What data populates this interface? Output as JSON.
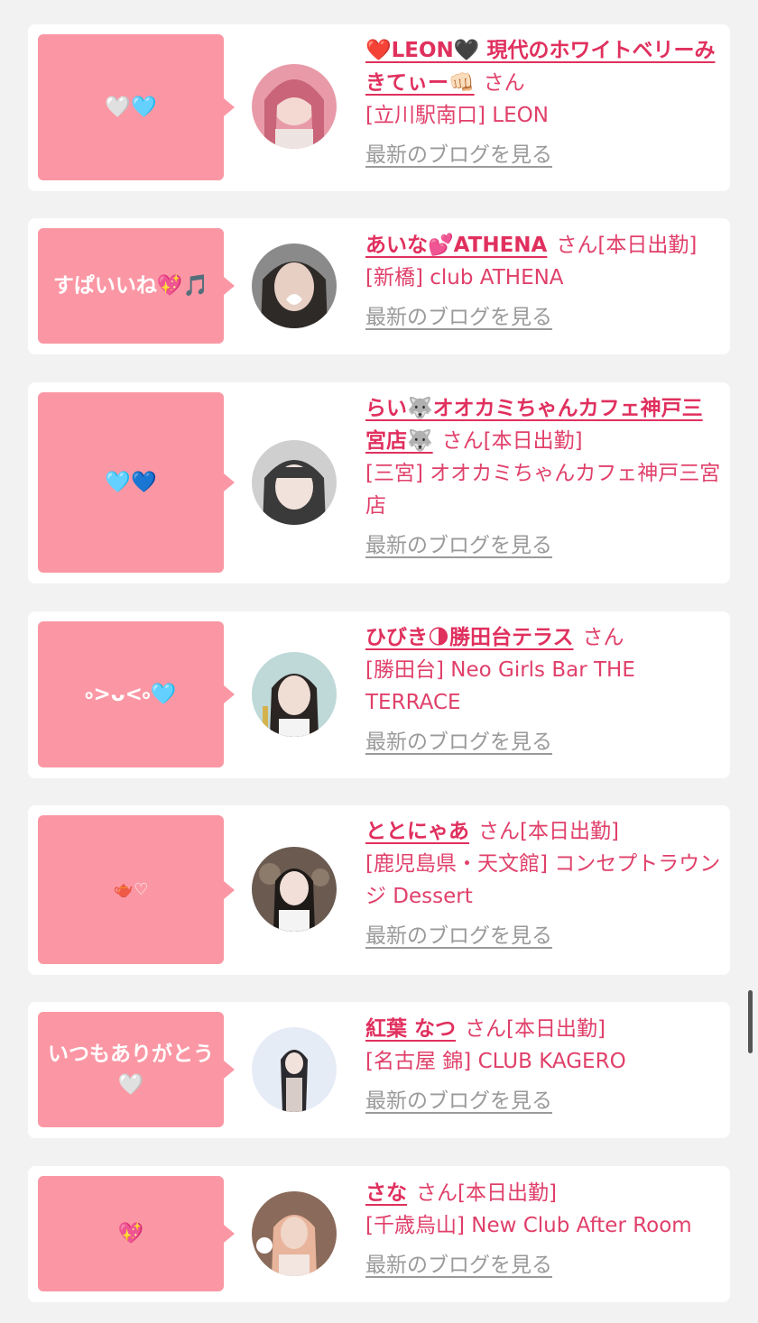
{
  "entries": [
    {
      "message": "🤍🩵",
      "name": "❤️LEON🖤 現代のホワイトベリーみきてぃー👊🏻",
      "suffix": "さん",
      "store": "[立川駅南口] LEON",
      "blog_link": "最新のブログを見る",
      "avatar_color": "#e89aa8"
    },
    {
      "message": "すぱいいね💖🎵",
      "name": "あいな💕ATHENA",
      "suffix": "さん[本日出勤]",
      "store": "[新橋] club ATHENA",
      "blog_link": "最新のブログを見る",
      "avatar_color": "#4a4a4a"
    },
    {
      "message": "🩵💙",
      "name": "らい🐺オオカミちゃんカフェ神戸三宮店🐺",
      "suffix": "さん[本日出勤]",
      "store": "[三宮] オオカミちゃんカフェ神戸三宮店",
      "blog_link": "最新のブログを見る",
      "avatar_color": "#5a5a5a"
    },
    {
      "message": "৹>ᴗ<৹🩵",
      "name": "ひびき🌗勝田台テラス",
      "suffix": "さん",
      "store": "[勝田台] Neo Girls Bar THE TERRACE",
      "blog_link": "最新のブログを見る",
      "avatar_color": "#bfd8d8"
    },
    {
      "message": "🫖♡",
      "name": "ととにゃあ",
      "suffix": "さん[本日出勤]",
      "store": "[鹿児島県・天文館] コンセプトラウンジ Dessert",
      "blog_link": "最新のブログを見る",
      "avatar_color": "#6a5a50"
    },
    {
      "message": "いつもありがとう🤍",
      "name": "紅葉 なつ",
      "suffix": "さん[本日出勤]",
      "store": "[名古屋 錦] CLUB KAGERO",
      "blog_link": "最新のブログを見る",
      "avatar_color": "#d9e4f2"
    },
    {
      "message": "💖",
      "name": "さな",
      "suffix": "さん[本日出勤]",
      "store": "[千歳烏山] New Club After Room",
      "blog_link": "最新のブログを見る",
      "avatar_color": "#c88878"
    }
  ]
}
